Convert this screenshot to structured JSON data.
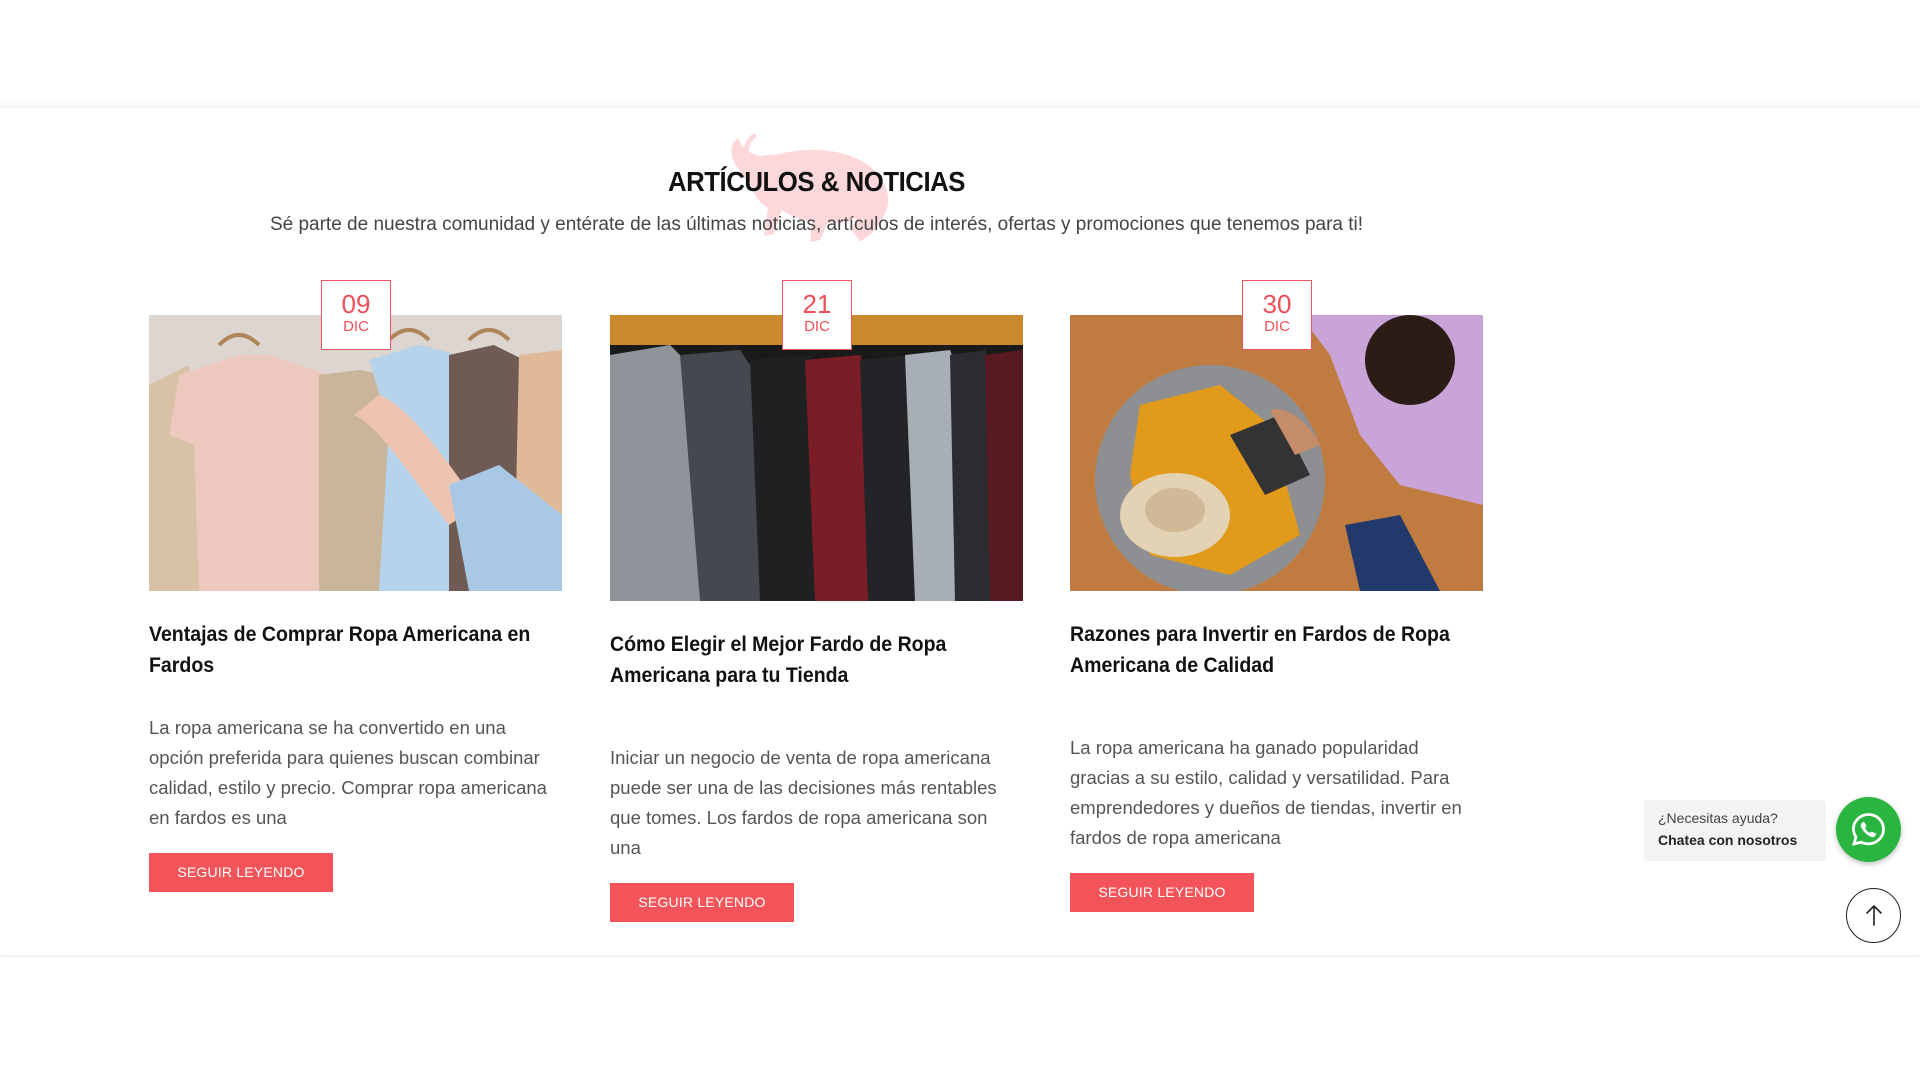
{
  "section": {
    "title": "ARTÍCULOS & NOTICIAS",
    "subtitle": "Sé parte de nuestra comunidad y entérate de las últimas noticias, artículos de interés, ofertas y promociones que tenemos para ti!"
  },
  "articles": [
    {
      "day": "09",
      "month": "DIC",
      "title": "Ventajas de Comprar Ropa Americana en Fardos",
      "excerpt": "La ropa americana se ha convertido en una opción preferida para quienes buscan combinar calidad, estilo y precio. Comprar ropa americana en fardos es una",
      "button": "SEGUIR LEYENDO"
    },
    {
      "day": "21",
      "month": "DIC",
      "title": "Cómo Elegir el Mejor Fardo de Ropa Americana para tu Tienda",
      "excerpt": "Iniciar un negocio de venta de ropa americana puede ser una de las decisiones más rentables que tomes. Los fardos de ropa americana son una",
      "button": "SEGUIR LEYENDO"
    },
    {
      "day": "30",
      "month": "DIC",
      "title": "Razones para Invertir en Fardos de Ropa Americana de Calidad",
      "excerpt": "La ropa americana ha ganado popularidad gracias a su estilo, calidad y versatilidad. Para emprendedores y dueños de tiendas, invertir en fardos de ropa americana",
      "button": "SEGUIR LEYENDO"
    }
  ],
  "chat": {
    "line1": "¿Necesitas ayuda?",
    "line2": "Chatea con nosotros"
  },
  "colors": {
    "accent": "#f3545a",
    "whatsapp": "#2ab540"
  },
  "icons": {
    "whatsapp": "whatsapp-icon",
    "scroll_top": "arrow-up-icon",
    "logo": "bull-logo"
  }
}
